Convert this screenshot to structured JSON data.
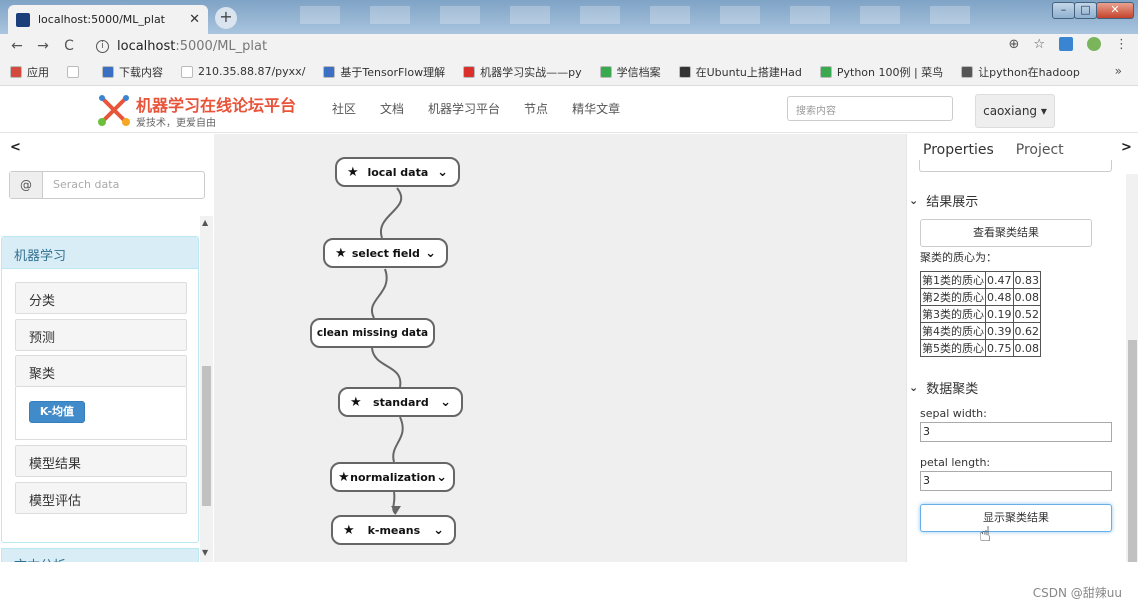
{
  "browser": {
    "tab_title": "localhost:5000/ML_plat",
    "tab_close": "✕",
    "new_tab": "+",
    "url_host": "localhost",
    "url_path": ":5000/ML_plat",
    "bookmarks": [
      {
        "label": "应用",
        "color": "#d24b3e"
      },
      {
        "label": "",
        "color": "#ffffff"
      },
      {
        "label": "下载内容",
        "color": "#3a6fc4"
      },
      {
        "label": "210.35.88.87/pyxx/",
        "color": "#ffffff"
      },
      {
        "label": "基于TensorFlow理解",
        "color": "#3a6fc4"
      },
      {
        "label": "机器学习实战——py",
        "color": "#d9302c"
      },
      {
        "label": "学信档案",
        "color": "#3aa84f"
      },
      {
        "label": "在Ubuntu上搭建Had",
        "color": "#333333"
      },
      {
        "label": "Python 100例 | 菜鸟",
        "color": "#3aa84f"
      },
      {
        "label": "让python在hadoop",
        "color": "#555555"
      }
    ],
    "bookmarks_more": "»"
  },
  "header": {
    "site_title": "机器学习在线论坛平台",
    "site_slogan": "爱技术，更爱自由",
    "nav": [
      "社区",
      "文档",
      "机器学习平台",
      "节点",
      "精华文章"
    ],
    "search_placeholder": "搜索内容",
    "user": "caoxiang ▾"
  },
  "left_panel": {
    "collapse": "<",
    "search_prefix": "@",
    "search_placeholder": "Serach data",
    "group_title": "机器学习",
    "items": [
      "分类",
      "预测",
      "聚类",
      "模型结果",
      "模型评估"
    ],
    "active_subitem": "K-均值",
    "next_group": "文本分析"
  },
  "canvas": {
    "nodes": [
      {
        "label": "local data"
      },
      {
        "label": "select field"
      },
      {
        "label": "clean missing data"
      },
      {
        "label": "standard"
      },
      {
        "label": "normalization"
      },
      {
        "label": "k-means"
      }
    ]
  },
  "right_panel": {
    "tabs": [
      "Properties",
      "Project"
    ],
    "collapse": ">",
    "section1_title": "结果展示",
    "view_button": "查看聚类结果",
    "centroid_label": "聚类的质心为：",
    "centroids": [
      [
        "第1类的质心",
        "0.47",
        "0.83"
      ],
      [
        "第2类的质心",
        "0.48",
        "0.08"
      ],
      [
        "第3类的质心",
        "0.19",
        "0.52"
      ],
      [
        "第4类的质心",
        "0.39",
        "0.62"
      ],
      [
        "第5类的质心",
        "0.75",
        "0.08"
      ]
    ],
    "section2_title": "数据聚类",
    "field1_label": "sepal width:",
    "field1_value": "3",
    "field2_label": "petal length:",
    "field2_value": "3",
    "show_button": "显示聚类结果"
  },
  "watermark": "CSDN @甜辣uu",
  "colors": {
    "accent": "#428bca",
    "brand": "#e8543a",
    "panel_head": "#d9edf7"
  }
}
